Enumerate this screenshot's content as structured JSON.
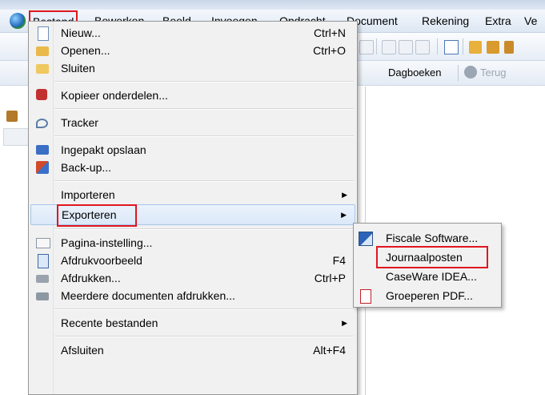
{
  "menubar": {
    "items": [
      "Bestand",
      "Bewerken",
      "Beeld",
      "Invoegen",
      "Opdracht",
      "Document",
      "Rekening",
      "Extra",
      "Ve"
    ]
  },
  "toolbar": {
    "dagboeken": "Dagboeken",
    "terug": "Terug"
  },
  "file_menu": {
    "items": [
      {
        "label": "Nieuw...",
        "shortcut": "Ctrl+N",
        "icon": "new-document-icon"
      },
      {
        "label": "Openen...",
        "shortcut": "Ctrl+O",
        "icon": "open-folder-icon"
      },
      {
        "label": "Sluiten",
        "shortcut": "",
        "icon": "close-folder-icon"
      },
      {
        "label": "Kopieer onderdelen...",
        "shortcut": "",
        "icon": "copy-parts-icon"
      },
      {
        "label": "Tracker",
        "shortcut": "",
        "icon": "tracker-icon"
      },
      {
        "label": "Ingepakt opslaan",
        "shortcut": "",
        "icon": "packed-save-icon"
      },
      {
        "label": "Back-up...",
        "shortcut": "",
        "icon": "backup-icon"
      },
      {
        "label": "Importeren",
        "shortcut": "",
        "icon": ""
      },
      {
        "label": "Exporteren",
        "shortcut": "",
        "icon": ""
      },
      {
        "label": "Pagina-instelling...",
        "shortcut": "",
        "icon": "page-setup-icon"
      },
      {
        "label": "Afdrukvoorbeeld",
        "shortcut": "F4",
        "icon": "print-preview-icon"
      },
      {
        "label": "Afdrukken...",
        "shortcut": "Ctrl+P",
        "icon": "print-icon"
      },
      {
        "label": "Meerdere documenten afdrukken...",
        "shortcut": "",
        "icon": "print-multiple-icon"
      },
      {
        "label": "Recente bestanden",
        "shortcut": "",
        "icon": ""
      },
      {
        "label": "Afsluiten",
        "shortcut": "Alt+F4",
        "icon": ""
      }
    ]
  },
  "export_submenu": {
    "items": [
      {
        "label": "Fiscale Software...",
        "icon": "fiscal-export-icon"
      },
      {
        "label": "Journaalposten",
        "icon": ""
      },
      {
        "label": "CaseWare IDEA...",
        "icon": ""
      },
      {
        "label": "Groeperen PDF...",
        "icon": "pdf-icon"
      }
    ]
  },
  "colors": {
    "highlight_border": "#e0161f",
    "menu_bg": "#f1f1f1"
  }
}
